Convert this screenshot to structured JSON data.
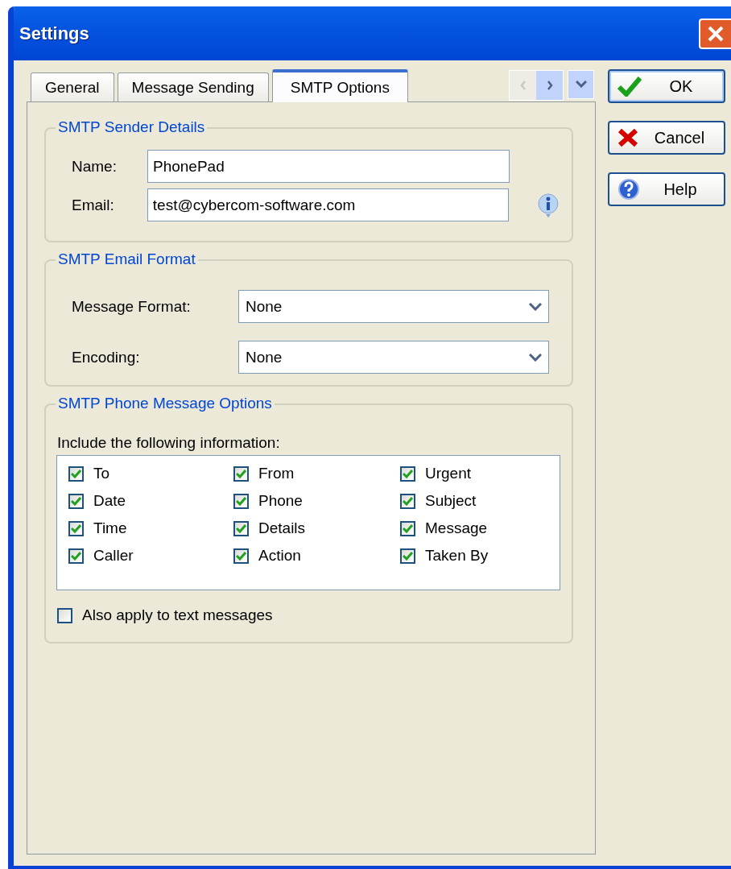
{
  "window": {
    "title": "Settings"
  },
  "tabs": [
    {
      "label": "General",
      "selected": false
    },
    {
      "label": "Message Sending",
      "selected": false
    },
    {
      "label": "SMTP Options",
      "selected": true
    }
  ],
  "sender_details": {
    "title": "SMTP Sender Details",
    "fields": [
      {
        "label": "Name:",
        "value": "PhonePad"
      },
      {
        "label": "Email:",
        "value": "test@cybercom-software.com"
      }
    ]
  },
  "email_format": {
    "title": "SMTP Email Format",
    "fields": [
      {
        "label": "Message Format:",
        "value": "None"
      },
      {
        "label": "Encoding:",
        "value": "None"
      }
    ]
  },
  "phone_message_options": {
    "title": "SMTP Phone Message Options",
    "prompt": "Include the following information:",
    "items": [
      {
        "label": "To",
        "checked": true
      },
      {
        "label": "From",
        "checked": true
      },
      {
        "label": "Urgent",
        "checked": true
      },
      {
        "label": "Date",
        "checked": true
      },
      {
        "label": "Phone",
        "checked": true
      },
      {
        "label": "Subject",
        "checked": true
      },
      {
        "label": "Time",
        "checked": true
      },
      {
        "label": "Details",
        "checked": true
      },
      {
        "label": "Message",
        "checked": true
      },
      {
        "label": "Caller",
        "checked": true
      },
      {
        "label": "Action",
        "checked": true
      },
      {
        "label": "Taken By",
        "checked": true
      }
    ],
    "also_apply": {
      "label": "Also apply to text messages",
      "checked": false
    }
  },
  "buttons": [
    {
      "kind": "ok",
      "label": "OK"
    },
    {
      "kind": "cancel",
      "label": "Cancel"
    },
    {
      "kind": "help",
      "label": "Help"
    }
  ]
}
